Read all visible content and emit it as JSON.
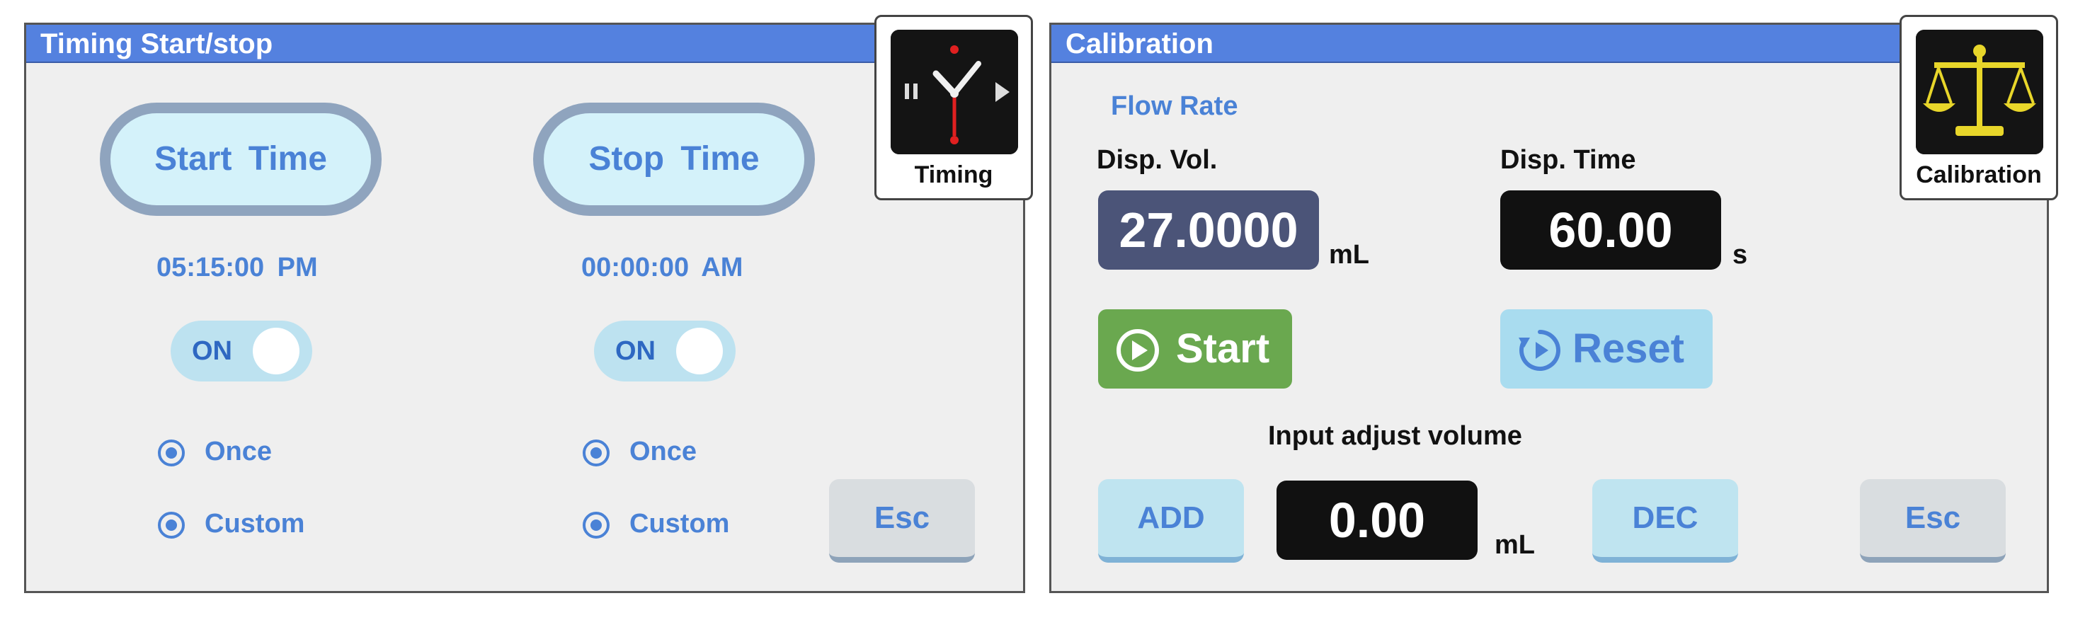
{
  "timing": {
    "title": "Timing Start/stop",
    "icon_label": "Timing",
    "start": {
      "button_label": "Start Time",
      "time": "05:15:00 PM",
      "toggle": "ON",
      "radio_once": "Once",
      "radio_custom": "Custom"
    },
    "stop": {
      "button_label": "Stop Time",
      "time": "00:00:00 AM",
      "toggle": "ON",
      "radio_once": "Once",
      "radio_custom": "Custom"
    },
    "esc_label": "Esc"
  },
  "calibration": {
    "title": "Calibration",
    "icon_label": "Calibration",
    "section_label": "Flow Rate",
    "disp_vol_label": "Disp. Vol.",
    "disp_vol_value": "27.0000",
    "disp_vol_unit": "mL",
    "disp_time_label": "Disp. Time",
    "disp_time_value": "60.00",
    "disp_time_unit": "s",
    "start_label": "Start",
    "reset_label": "Reset",
    "adjust_label": "Input adjust volume",
    "add_label": "ADD",
    "adjust_value": "0.00",
    "adjust_unit": "mL",
    "dec_label": "DEC",
    "esc_label": "Esc"
  },
  "colors": {
    "title_bar": "#5481df",
    "accent_text": "#4a82d6",
    "start_green": "#6aa84f",
    "reset_light_blue": "#a9dcef",
    "disp_vol_box": "#4b5478",
    "dark_box": "#111111"
  },
  "icons": {
    "timing": "clock-icon",
    "calibration": "balance-scale-icon",
    "start": "play-circle-icon",
    "reset": "reset-icon"
  }
}
